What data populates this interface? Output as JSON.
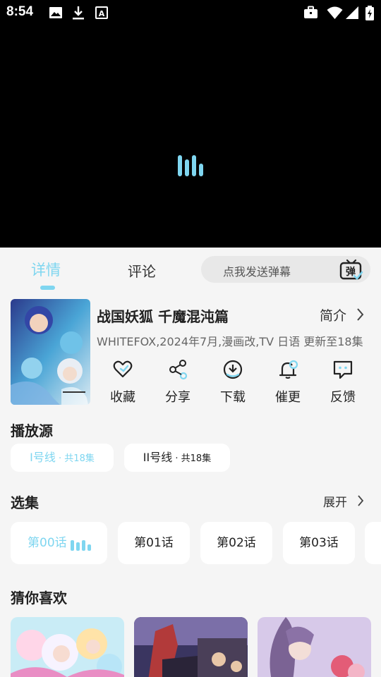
{
  "status_bar": {
    "time": "8:54",
    "left_icons": [
      "image-icon",
      "download-icon",
      "text-a-icon"
    ],
    "right_icons": [
      "briefcase-icon",
      "wifi-icon",
      "signal-icon",
      "battery-icon"
    ]
  },
  "player": {
    "state": "loading",
    "indicator_color": "#7fd6f0"
  },
  "tabs": {
    "detail": "详情",
    "comment": "评论",
    "active": "详情"
  },
  "danmaku": {
    "placeholder": "点我发送弹幕",
    "icon_label": "弹"
  },
  "anime": {
    "title": "战国妖狐 千魔混沌篇",
    "intro_label": "简介",
    "meta": "WHITEFOX,2024年7月,漫画改,TV 日语 更新至18集"
  },
  "actions": [
    {
      "icon": "heart-icon",
      "label": "收藏"
    },
    {
      "icon": "share-icon",
      "label": "分享"
    },
    {
      "icon": "download-icon",
      "label": "下载"
    },
    {
      "icon": "bell-icon",
      "label": "催更"
    },
    {
      "icon": "feedback-icon",
      "label": "反馈"
    }
  ],
  "sources": {
    "title": "播放源",
    "items": [
      {
        "name": "I号线",
        "sep": " · ",
        "count": "共18集",
        "selected": true
      },
      {
        "name": "II号线",
        "sep": " · ",
        "count": "共18集",
        "selected": false
      }
    ]
  },
  "episodes": {
    "title": "选集",
    "expand_label": "展开",
    "items": [
      "第00话",
      "第01话",
      "第02话",
      "第03话"
    ],
    "playing": "第00话"
  },
  "recommend": {
    "title": "猜你喜欢"
  },
  "colors": {
    "accent": "#7fd6f0",
    "background": "#f5f5f5",
    "card": "#ffffff"
  }
}
